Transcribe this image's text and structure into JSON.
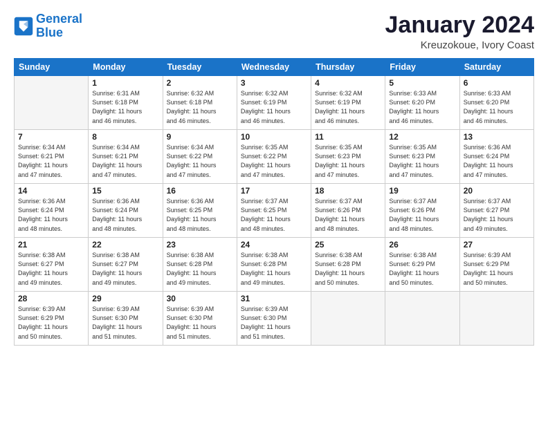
{
  "logo": {
    "line1": "General",
    "line2": "Blue"
  },
  "title": "January 2024",
  "subtitle": "Kreuzokoue, Ivory Coast",
  "weekdays": [
    "Sunday",
    "Monday",
    "Tuesday",
    "Wednesday",
    "Thursday",
    "Friday",
    "Saturday"
  ],
  "weeks": [
    [
      {
        "day": "",
        "sunrise": "",
        "sunset": "",
        "daylight": "",
        "empty": true
      },
      {
        "day": "1",
        "sunrise": "Sunrise: 6:31 AM",
        "sunset": "Sunset: 6:18 PM",
        "daylight": "Daylight: 11 hours and 46 minutes."
      },
      {
        "day": "2",
        "sunrise": "Sunrise: 6:32 AM",
        "sunset": "Sunset: 6:18 PM",
        "daylight": "Daylight: 11 hours and 46 minutes."
      },
      {
        "day": "3",
        "sunrise": "Sunrise: 6:32 AM",
        "sunset": "Sunset: 6:19 PM",
        "daylight": "Daylight: 11 hours and 46 minutes."
      },
      {
        "day": "4",
        "sunrise": "Sunrise: 6:32 AM",
        "sunset": "Sunset: 6:19 PM",
        "daylight": "Daylight: 11 hours and 46 minutes."
      },
      {
        "day": "5",
        "sunrise": "Sunrise: 6:33 AM",
        "sunset": "Sunset: 6:20 PM",
        "daylight": "Daylight: 11 hours and 46 minutes."
      },
      {
        "day": "6",
        "sunrise": "Sunrise: 6:33 AM",
        "sunset": "Sunset: 6:20 PM",
        "daylight": "Daylight: 11 hours and 46 minutes."
      }
    ],
    [
      {
        "day": "7",
        "sunrise": "Sunrise: 6:34 AM",
        "sunset": "Sunset: 6:21 PM",
        "daylight": "Daylight: 11 hours and 47 minutes."
      },
      {
        "day": "8",
        "sunrise": "Sunrise: 6:34 AM",
        "sunset": "Sunset: 6:21 PM",
        "daylight": "Daylight: 11 hours and 47 minutes."
      },
      {
        "day": "9",
        "sunrise": "Sunrise: 6:34 AM",
        "sunset": "Sunset: 6:22 PM",
        "daylight": "Daylight: 11 hours and 47 minutes."
      },
      {
        "day": "10",
        "sunrise": "Sunrise: 6:35 AM",
        "sunset": "Sunset: 6:22 PM",
        "daylight": "Daylight: 11 hours and 47 minutes."
      },
      {
        "day": "11",
        "sunrise": "Sunrise: 6:35 AM",
        "sunset": "Sunset: 6:23 PM",
        "daylight": "Daylight: 11 hours and 47 minutes."
      },
      {
        "day": "12",
        "sunrise": "Sunrise: 6:35 AM",
        "sunset": "Sunset: 6:23 PM",
        "daylight": "Daylight: 11 hours and 47 minutes."
      },
      {
        "day": "13",
        "sunrise": "Sunrise: 6:36 AM",
        "sunset": "Sunset: 6:24 PM",
        "daylight": "Daylight: 11 hours and 47 minutes."
      }
    ],
    [
      {
        "day": "14",
        "sunrise": "Sunrise: 6:36 AM",
        "sunset": "Sunset: 6:24 PM",
        "daylight": "Daylight: 11 hours and 48 minutes."
      },
      {
        "day": "15",
        "sunrise": "Sunrise: 6:36 AM",
        "sunset": "Sunset: 6:24 PM",
        "daylight": "Daylight: 11 hours and 48 minutes."
      },
      {
        "day": "16",
        "sunrise": "Sunrise: 6:36 AM",
        "sunset": "Sunset: 6:25 PM",
        "daylight": "Daylight: 11 hours and 48 minutes."
      },
      {
        "day": "17",
        "sunrise": "Sunrise: 6:37 AM",
        "sunset": "Sunset: 6:25 PM",
        "daylight": "Daylight: 11 hours and 48 minutes."
      },
      {
        "day": "18",
        "sunrise": "Sunrise: 6:37 AM",
        "sunset": "Sunset: 6:26 PM",
        "daylight": "Daylight: 11 hours and 48 minutes."
      },
      {
        "day": "19",
        "sunrise": "Sunrise: 6:37 AM",
        "sunset": "Sunset: 6:26 PM",
        "daylight": "Daylight: 11 hours and 48 minutes."
      },
      {
        "day": "20",
        "sunrise": "Sunrise: 6:37 AM",
        "sunset": "Sunset: 6:27 PM",
        "daylight": "Daylight: 11 hours and 49 minutes."
      }
    ],
    [
      {
        "day": "21",
        "sunrise": "Sunrise: 6:38 AM",
        "sunset": "Sunset: 6:27 PM",
        "daylight": "Daylight: 11 hours and 49 minutes."
      },
      {
        "day": "22",
        "sunrise": "Sunrise: 6:38 AM",
        "sunset": "Sunset: 6:27 PM",
        "daylight": "Daylight: 11 hours and 49 minutes."
      },
      {
        "day": "23",
        "sunrise": "Sunrise: 6:38 AM",
        "sunset": "Sunset: 6:28 PM",
        "daylight": "Daylight: 11 hours and 49 minutes."
      },
      {
        "day": "24",
        "sunrise": "Sunrise: 6:38 AM",
        "sunset": "Sunset: 6:28 PM",
        "daylight": "Daylight: 11 hours and 49 minutes."
      },
      {
        "day": "25",
        "sunrise": "Sunrise: 6:38 AM",
        "sunset": "Sunset: 6:28 PM",
        "daylight": "Daylight: 11 hours and 50 minutes."
      },
      {
        "day": "26",
        "sunrise": "Sunrise: 6:38 AM",
        "sunset": "Sunset: 6:29 PM",
        "daylight": "Daylight: 11 hours and 50 minutes."
      },
      {
        "day": "27",
        "sunrise": "Sunrise: 6:39 AM",
        "sunset": "Sunset: 6:29 PM",
        "daylight": "Daylight: 11 hours and 50 minutes."
      }
    ],
    [
      {
        "day": "28",
        "sunrise": "Sunrise: 6:39 AM",
        "sunset": "Sunset: 6:29 PM",
        "daylight": "Daylight: 11 hours and 50 minutes."
      },
      {
        "day": "29",
        "sunrise": "Sunrise: 6:39 AM",
        "sunset": "Sunset: 6:30 PM",
        "daylight": "Daylight: 11 hours and 51 minutes."
      },
      {
        "day": "30",
        "sunrise": "Sunrise: 6:39 AM",
        "sunset": "Sunset: 6:30 PM",
        "daylight": "Daylight: 11 hours and 51 minutes."
      },
      {
        "day": "31",
        "sunrise": "Sunrise: 6:39 AM",
        "sunset": "Sunset: 6:30 PM",
        "daylight": "Daylight: 11 hours and 51 minutes."
      },
      {
        "day": "",
        "sunrise": "",
        "sunset": "",
        "daylight": "",
        "empty": true
      },
      {
        "day": "",
        "sunrise": "",
        "sunset": "",
        "daylight": "",
        "empty": true
      },
      {
        "day": "",
        "sunrise": "",
        "sunset": "",
        "daylight": "",
        "empty": true
      }
    ]
  ]
}
